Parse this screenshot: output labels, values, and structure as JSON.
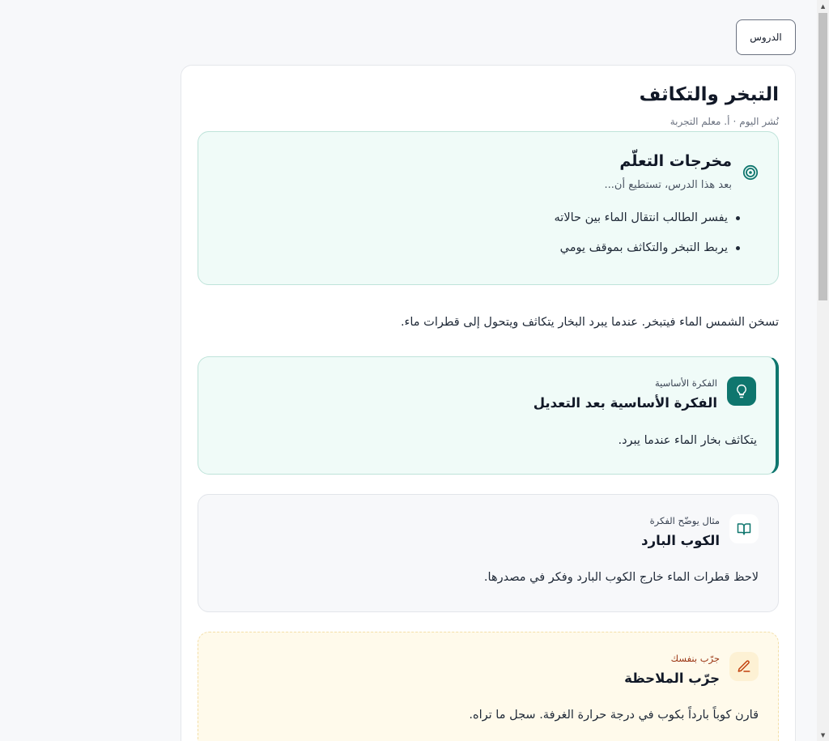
{
  "nav": {
    "lessons_button": "الدروس"
  },
  "lesson": {
    "title": "التبخر والتكاثف",
    "published": "نُشر اليوم",
    "separator": "·",
    "author": "أ. معلم التجربة"
  },
  "outcomes": {
    "title": "مخرجات التعلّم",
    "subtitle": "بعد هذا الدرس، تستطيع أن...",
    "items": [
      "يفسر الطالب انتقال الماء بين حالاته",
      "يربط التبخر والتكاثف بموقف يومي"
    ],
    "icon": "target-icon"
  },
  "intro": "تسخن الشمس الماء فيتبخر. عندما يبرد البخار يتكاثف ويتحول إلى قطرات ماء.",
  "core_idea": {
    "label": "الفكرة الأساسية",
    "heading": "الفكرة الأساسية بعد التعديل",
    "text": "يتكاثف بخار الماء عندما يبرد.",
    "icon": "lightbulb-icon",
    "accent": "#0f766e"
  },
  "example": {
    "label": "مثال يوضّح الفكرة",
    "heading": "الكوب البارد",
    "text": "لاحظ قطرات الماء خارج الكوب البارد وفكر في مصدرها.",
    "icon": "book-icon"
  },
  "try_it": {
    "label": "جرّب بنفسك",
    "heading": "جرّب الملاحظة",
    "text": "قارن كوباً بارداً بكوب في درجة حرارة الغرفة. سجل ما تراه.",
    "icon": "pencil-icon"
  }
}
